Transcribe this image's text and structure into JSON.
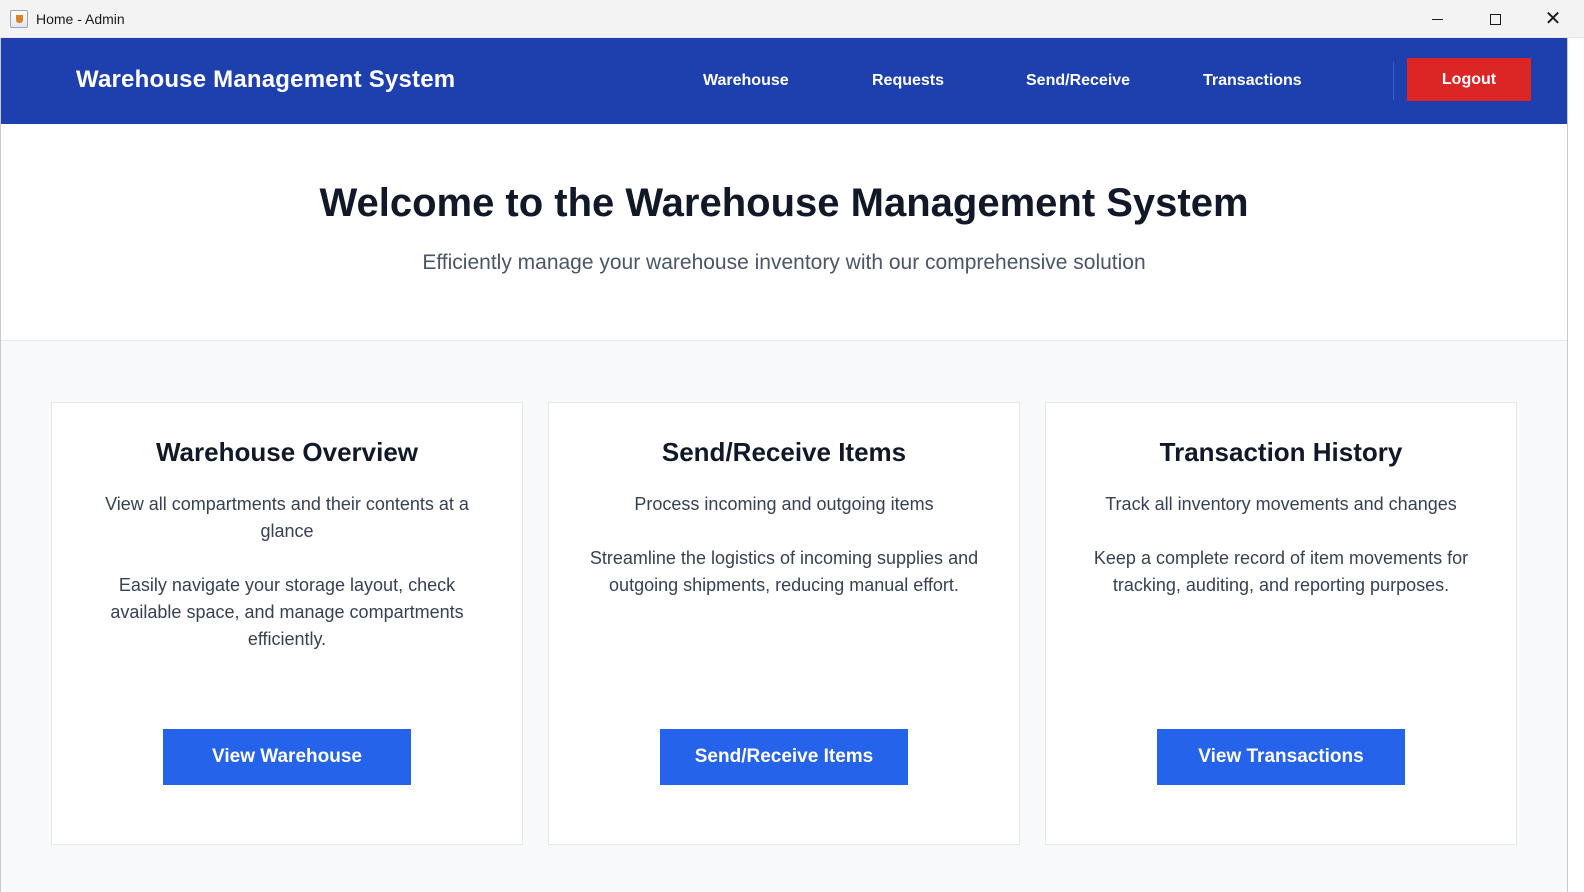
{
  "window": {
    "title": "Home - Admin",
    "icon": "java-app-icon",
    "controls": [
      "minimize",
      "maximize",
      "close"
    ]
  },
  "navbar": {
    "brand": "Warehouse Management System",
    "links": [
      "Warehouse",
      "Requests",
      "Send/Receive",
      "Transactions"
    ],
    "logout_label": "Logout",
    "colors": {
      "background": "#1e40af",
      "logout": "#dc2626"
    }
  },
  "hero": {
    "title": "Welcome to the Warehouse Management System",
    "subtitle": "Efficiently manage your warehouse inventory with our comprehensive solution"
  },
  "cards": [
    {
      "title": "Warehouse Overview",
      "summary": "View all compartments and their contents at a glance",
      "detail": "Easily navigate your storage layout, check available space, and manage compartments efficiently.",
      "button": "View Warehouse"
    },
    {
      "title": "Send/Receive Items",
      "summary": "Process incoming and outgoing items",
      "detail": "Streamline the logistics of incoming supplies and outgoing shipments, reducing manual effort.",
      "button": "Send/Receive Items"
    },
    {
      "title": "Transaction History",
      "summary": "Track all inventory movements and changes",
      "detail": "Keep a complete record of item movements for tracking, auditing, and reporting purposes.",
      "button": "View Transactions"
    }
  ],
  "colors": {
    "primary_button": "#2563eb",
    "page_background": "#f8f9fb"
  }
}
